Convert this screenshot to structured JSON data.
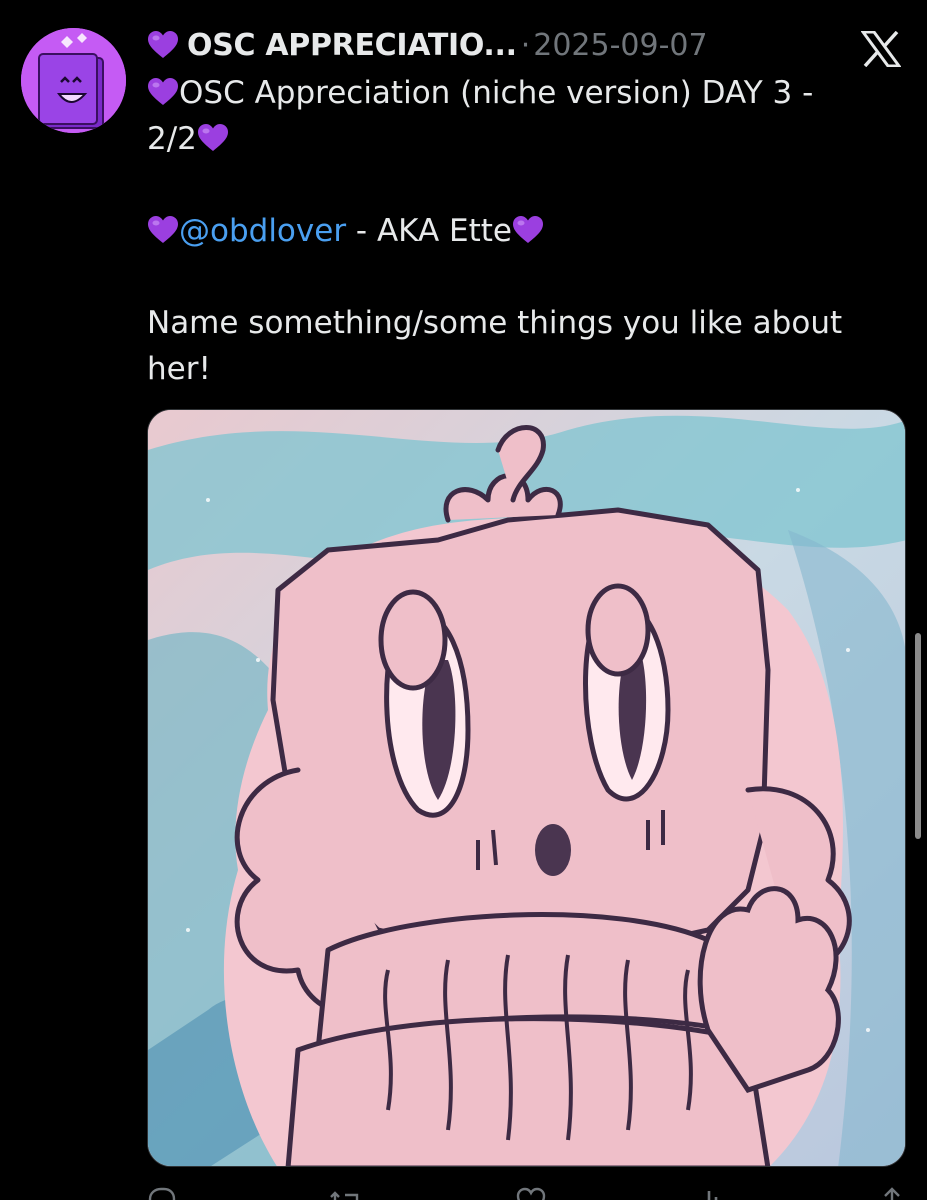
{
  "tweet": {
    "display_name": "OSC APPRECIATIO...",
    "separator": "·",
    "timestamp": "2025-09-07",
    "line1": "OSC Appreciation (niche version) DAY 3 -",
    "line2": "2/2",
    "mention": "@obdlover",
    "aka": " - AKA Ette",
    "body": "Name something/some things you like about",
    "body2": "her!"
  },
  "icons": {
    "heart": "purple-heart-emoji",
    "platform_logo": "x-logo"
  },
  "actions": [
    {
      "name": "reply",
      "icon": "reply-icon"
    },
    {
      "name": "repost",
      "icon": "repost-icon"
    },
    {
      "name": "like",
      "icon": "like-icon"
    },
    {
      "name": "views",
      "icon": "views-icon"
    },
    {
      "name": "share",
      "icon": "share-icon"
    }
  ],
  "colors": {
    "background": "#000000",
    "text": "#e7e9ea",
    "muted": "#71767b",
    "mention": "#4a9ff0",
    "heart": "#9b3fe0",
    "avatar_bg": "#c55bf4"
  }
}
